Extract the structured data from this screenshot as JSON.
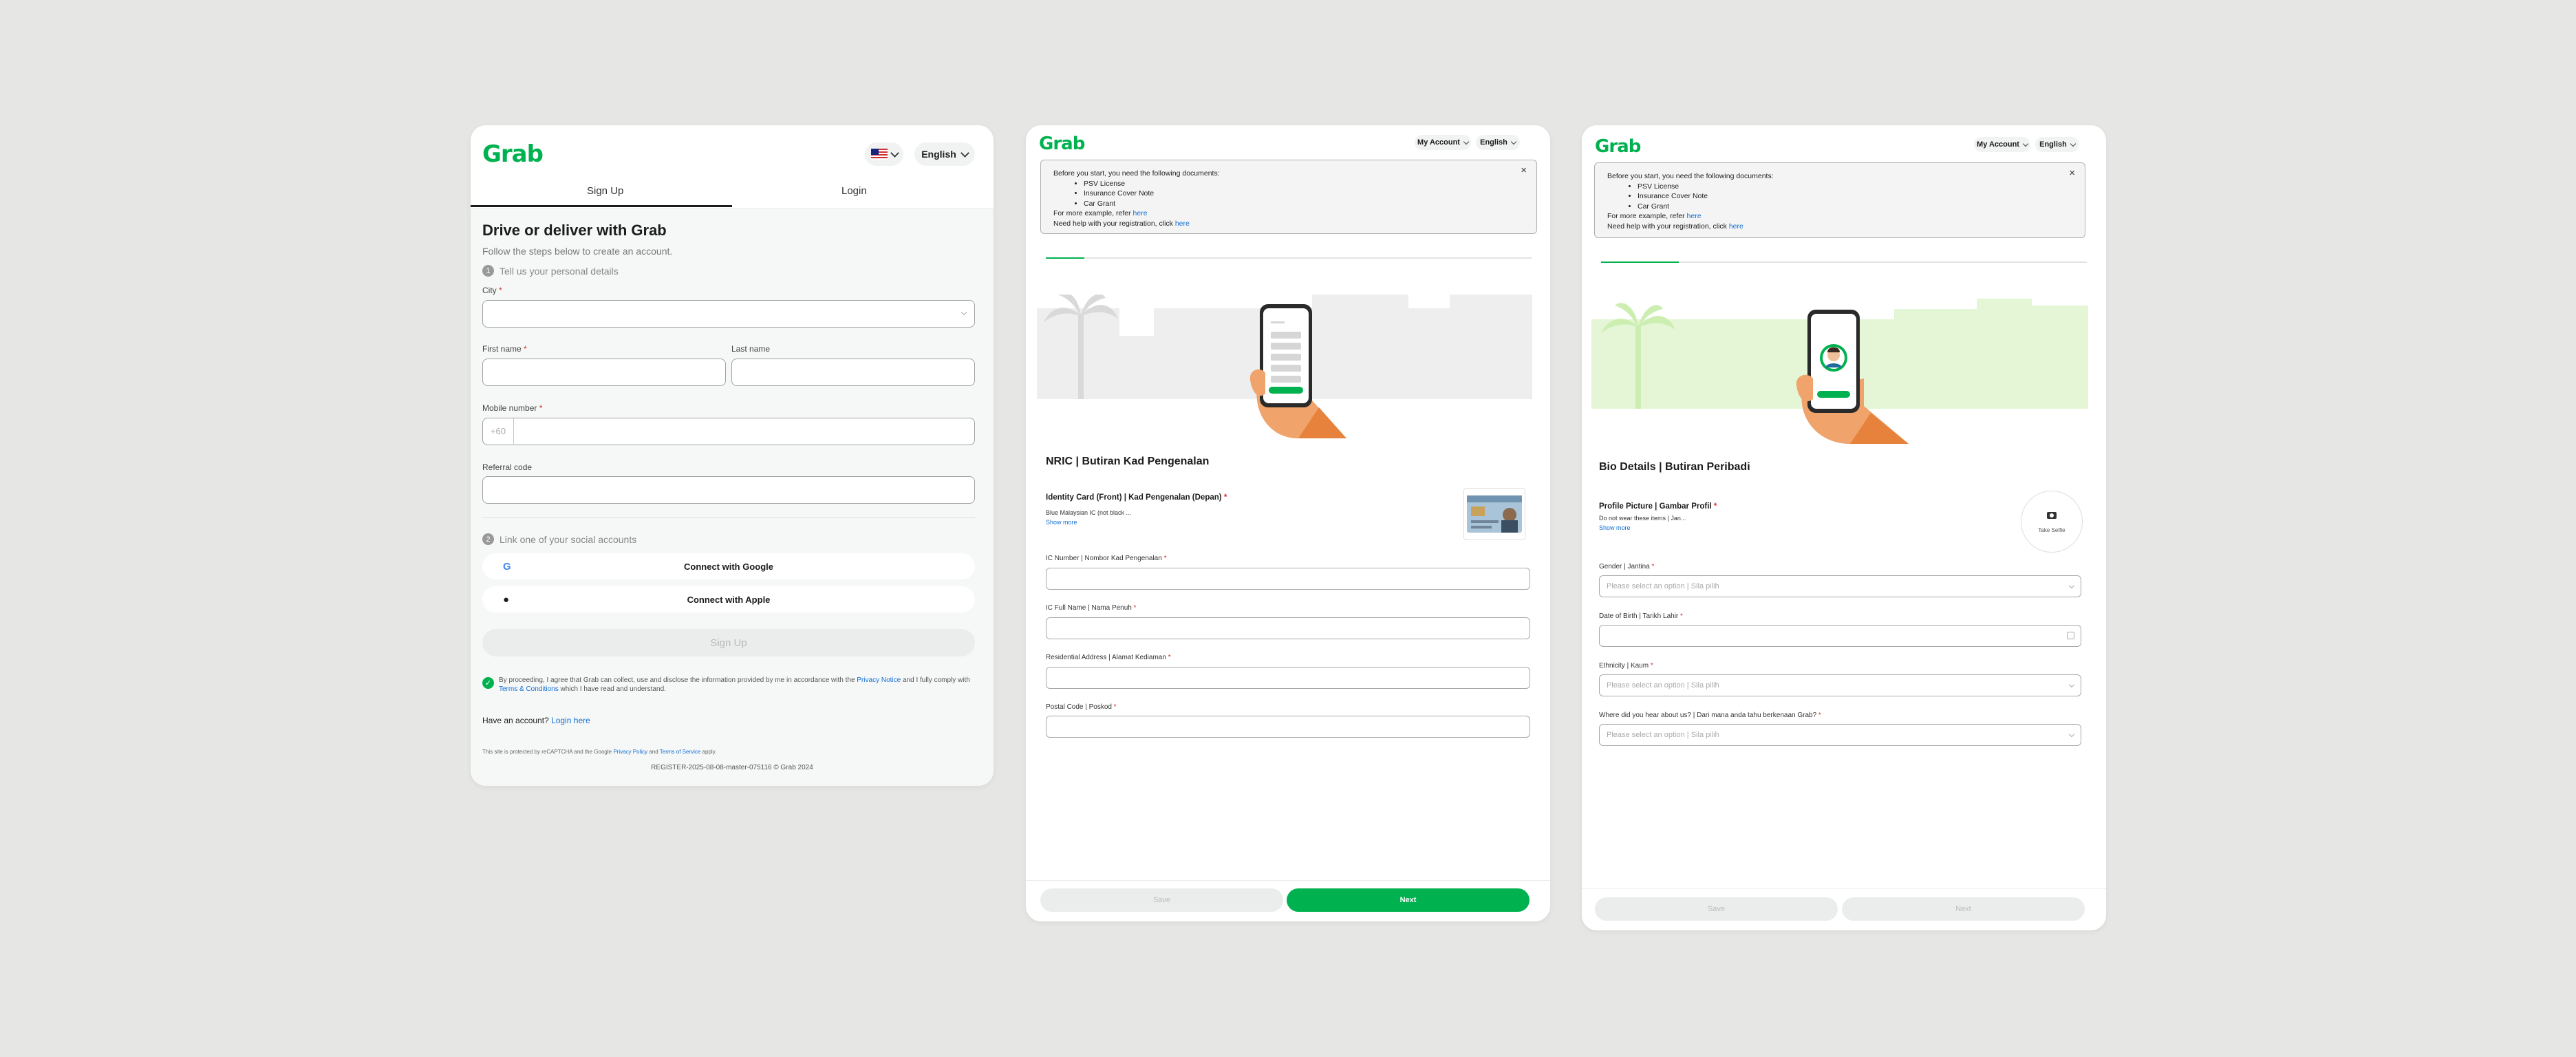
{
  "card1": {
    "logo": "Grab",
    "language": "English",
    "tabs": [
      "Sign Up",
      "Login"
    ],
    "title": "Drive or deliver with Grab",
    "subtitle": "Follow the steps below to create an account.",
    "step1": {
      "num": "1",
      "label": "Tell us your personal details"
    },
    "city_label": "City",
    "first_name_label": "First name",
    "last_name_label": "Last name",
    "mobile_label": "Mobile number",
    "mobile_prefix": "+60",
    "referral_label": "Referral code",
    "step2": {
      "num": "2",
      "label": "Link one of your social accounts"
    },
    "google_btn": "Connect with Google",
    "apple_btn": "Connect with Apple",
    "signup_btn": "Sign Up",
    "consent_pre": "By proceeding, I agree that Grab can collect, use and disclose the information provided by me in accordance with the ",
    "privacy_link": "Privacy Notice",
    "consent_mid": " and I fully comply with ",
    "terms_link": "Terms & Conditions",
    "consent_post": " which I have read and understand.",
    "have_account": "Have an account?",
    "login_link": "Login here",
    "recaptcha_pre": "This site is protected by reCAPTCHA and the Google ",
    "recaptcha_privacy": "Privacy Policy",
    "recaptcha_and": " and ",
    "recaptcha_terms": "Terms of Service",
    "recaptcha_post": " apply.",
    "version": "REGISTER-2025-08-08-master-075116 © Grab 2024"
  },
  "nav": {
    "logo": "Grab",
    "account": "My Account",
    "language": "English"
  },
  "notice": {
    "intro": "Before you start, you need the following documents:",
    "docs": [
      "PSV License",
      "Insurance Cover Note",
      "Car Grant"
    ],
    "more_pre": "For more example, refer ",
    "more_link": "here",
    "help_pre": "Need help with your registration, click ",
    "help_link": "here",
    "close": "×"
  },
  "card2": {
    "section_title": "NRIC | Butiran Kad Pengenalan",
    "doc_title": "Identity Card (Front) | Kad Pengenalan (Depan)",
    "doc_desc": "Blue Malaysian IC (not black ...",
    "show_more": "Show more",
    "fields": [
      "IC Number | Nombor Kad Pengenalan",
      "IC Full Name | Nama Penuh",
      "Residential Address | Alamat Kediaman",
      "Postal Code | Poskod"
    ],
    "progress": 0.08,
    "save": "Save",
    "next": "Next"
  },
  "card3": {
    "section_title": "Bio Details | Butiran Peribadi",
    "pic_title": "Profile Picture | Gambar Profil",
    "pic_desc": "Do not wear these items | Jan...",
    "show_more": "Show more",
    "selfie": "Take Selfie",
    "fields": [
      {
        "label": "Gender | Jantina",
        "placeholder": "Please select an option | Sila pilih"
      },
      {
        "label": "Date of Birth | Tarikh Lahir",
        "placeholder": ""
      },
      {
        "label": "Ethnicity | Kaum",
        "placeholder": "Please select an option | Sila pilih"
      },
      {
        "label": "Where did you hear about us? | Dari mana anda tahu berkenaan Grab?",
        "placeholder": "Please select an option | Sila pilih"
      }
    ],
    "progress": 0.16,
    "save": "Save",
    "next": "Next"
  },
  "colors": {
    "brand": "#00b14f",
    "link": "#136fd4",
    "required": "#d0312d"
  }
}
